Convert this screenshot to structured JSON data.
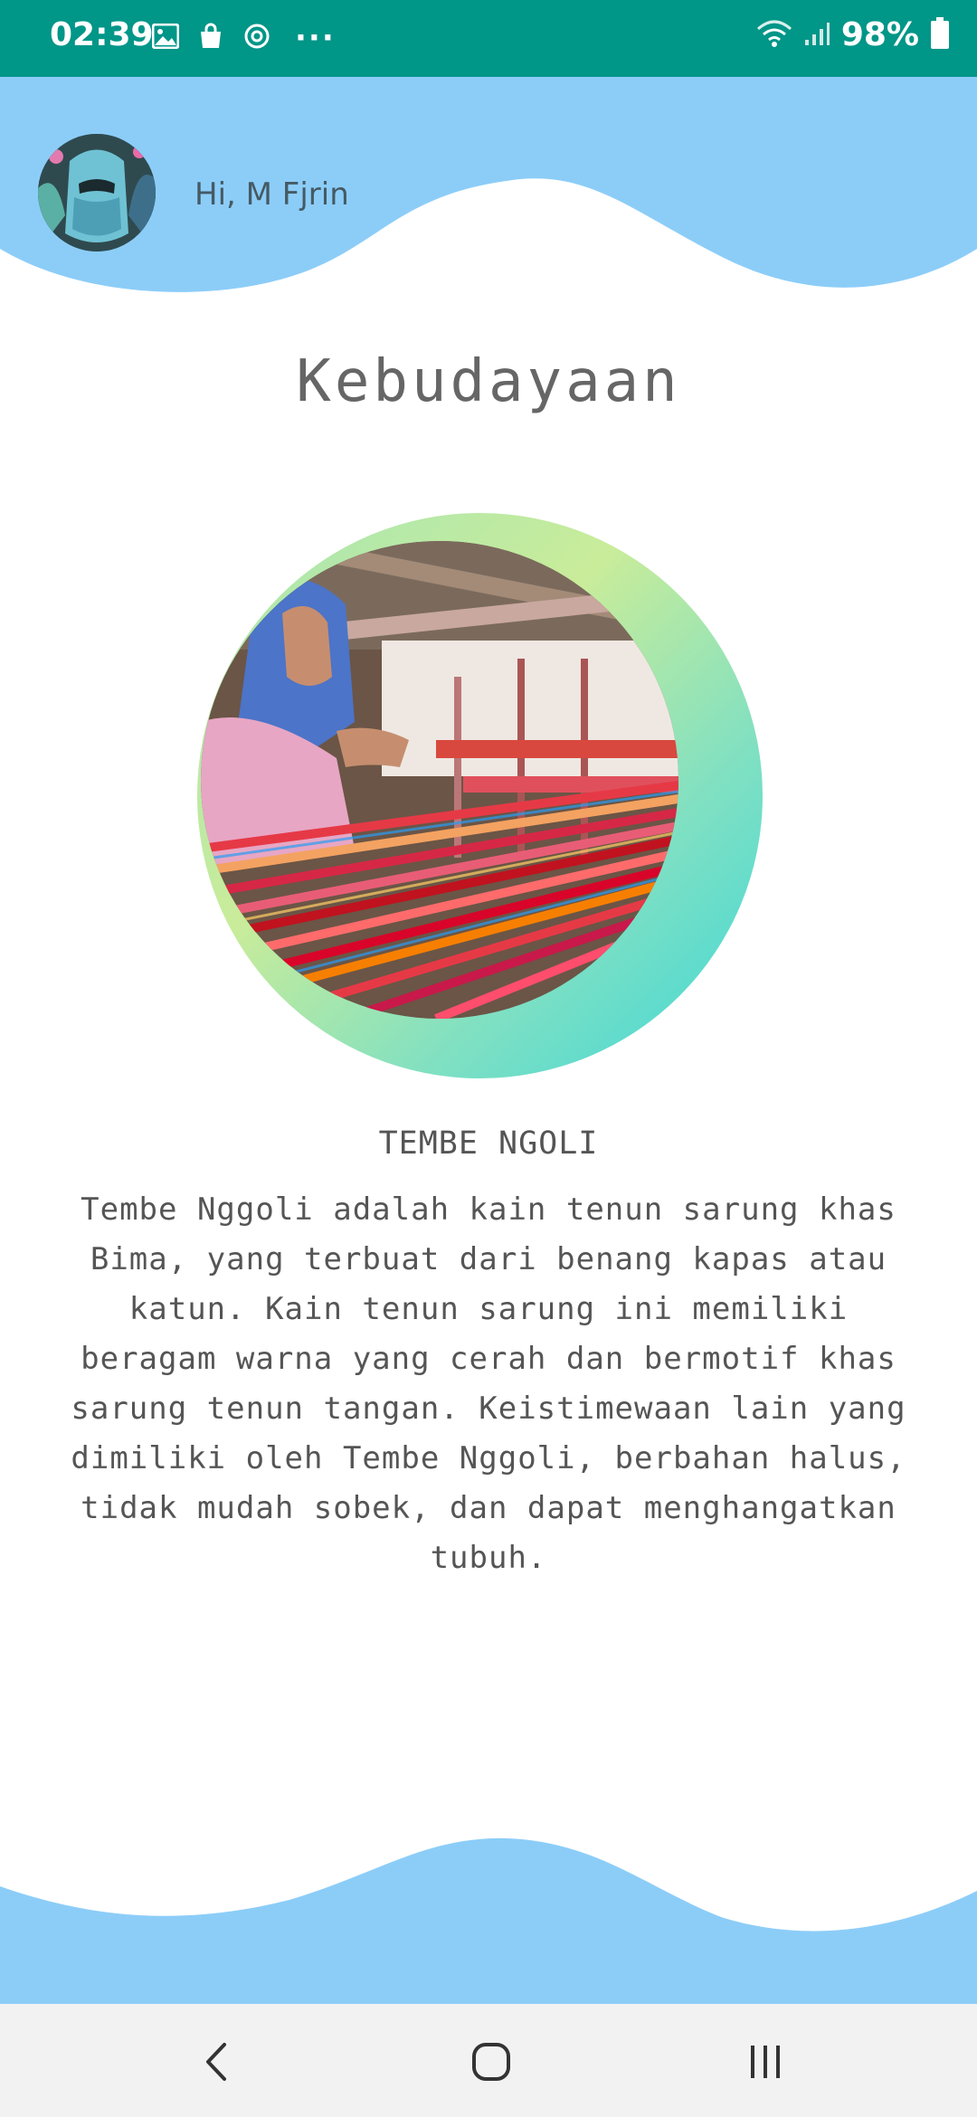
{
  "status_bar": {
    "time": "02:39",
    "battery": "98%",
    "more": "···",
    "left_icons": [
      "image-icon",
      "shopping-bag-icon",
      "sync-icon"
    ],
    "right_icons": [
      "wifi-icon",
      "signal-icon",
      "battery-icon"
    ]
  },
  "header": {
    "greeting": "Hi, M Fjrin",
    "avatar": "avatar"
  },
  "page": {
    "title": "Kebudayaan"
  },
  "content": {
    "subtitle": "TEMBE NGOLI",
    "description": "Tembe Nggoli adalah kain tenun sarung khas Bima,  yang terbuat dari benang kapas atau katun. Kain tenun sarung ini memiliki beragam warna yang cerah dan bermotif khas sarung tenun tangan. Keistimewaan lain yang dimiliki oleh Tembe Nggoli, berbahan halus, tidak mudah sobek, dan dapat menghangatkan tubuh."
  },
  "nav": {
    "back": "back-icon",
    "home": "home-icon",
    "recents": "recents-icon"
  },
  "colors": {
    "status_bar": "#009688",
    "wave": "#8ccdf8",
    "text": "#555555",
    "nav_bg": "#f2f2f2"
  }
}
